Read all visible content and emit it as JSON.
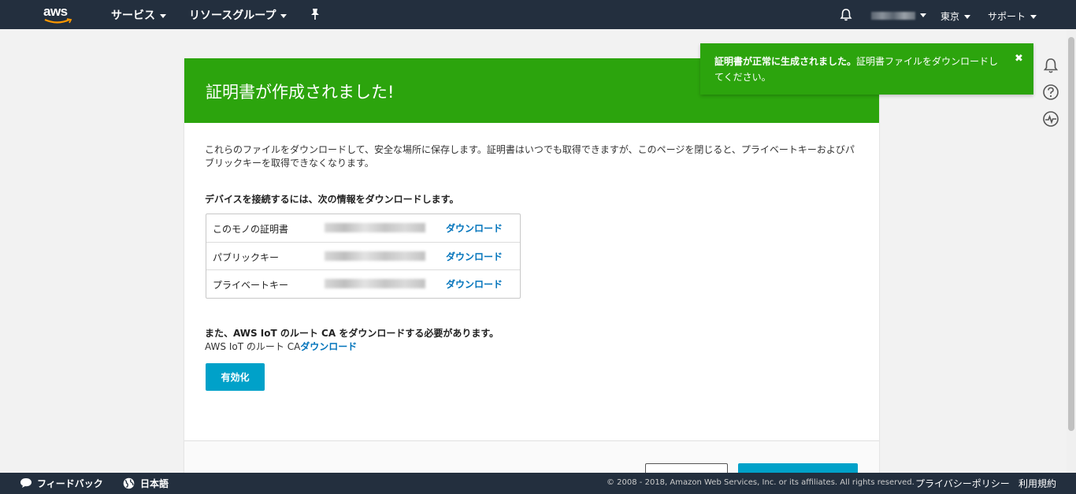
{
  "nav": {
    "logo_text": "aws",
    "services": "サービス",
    "resource_groups": "リソースグループ",
    "region": "東京",
    "support": "サポート"
  },
  "toast": {
    "bold": "証明書が正常に生成されました。",
    "rest": "証明書ファイルをダウンロードしてください。",
    "close": "✖"
  },
  "card": {
    "title": "証明書が作成されました!",
    "description": "これらのファイルをダウンロードして、安全な場所に保存します。証明書はいつでも取得できますが、このページを閉じると、プライベートキーおよびパブリックキーを取得できなくなります。",
    "subheading": "デバイスを接続するには、次の情報をダウンロードします。",
    "downloads": [
      {
        "label": "このモノの証明書",
        "link": "ダウンロード"
      },
      {
        "label": "パブリックキー",
        "link": "ダウンロード"
      },
      {
        "label": "プライベートキー",
        "link": "ダウンロード"
      }
    ],
    "ca_note": "また、AWS IoT のルート CA をダウンロードする必要があります。",
    "ca_prefix": "AWS IoT のルート CA",
    "ca_link": "ダウンロード",
    "activate": "有効化"
  },
  "footer": {
    "feedback": "フィードバック",
    "language": "日本語",
    "copyright": "© 2008 - 2018, Amazon Web Services, Inc. or its affiliates. All rights reserved.",
    "privacy": "プライバシーポリシー",
    "terms": "利用規約"
  },
  "colors": {
    "nav_bg": "#232f3e",
    "success_green": "#2ca40d",
    "link_blue": "#0073bb",
    "button_blue": "#00a1c9"
  },
  "icons": [
    "bell-icon",
    "pin-icon",
    "help-icon",
    "activity-icon",
    "chat-bubble-icon",
    "globe-icon",
    "close-icon"
  ]
}
